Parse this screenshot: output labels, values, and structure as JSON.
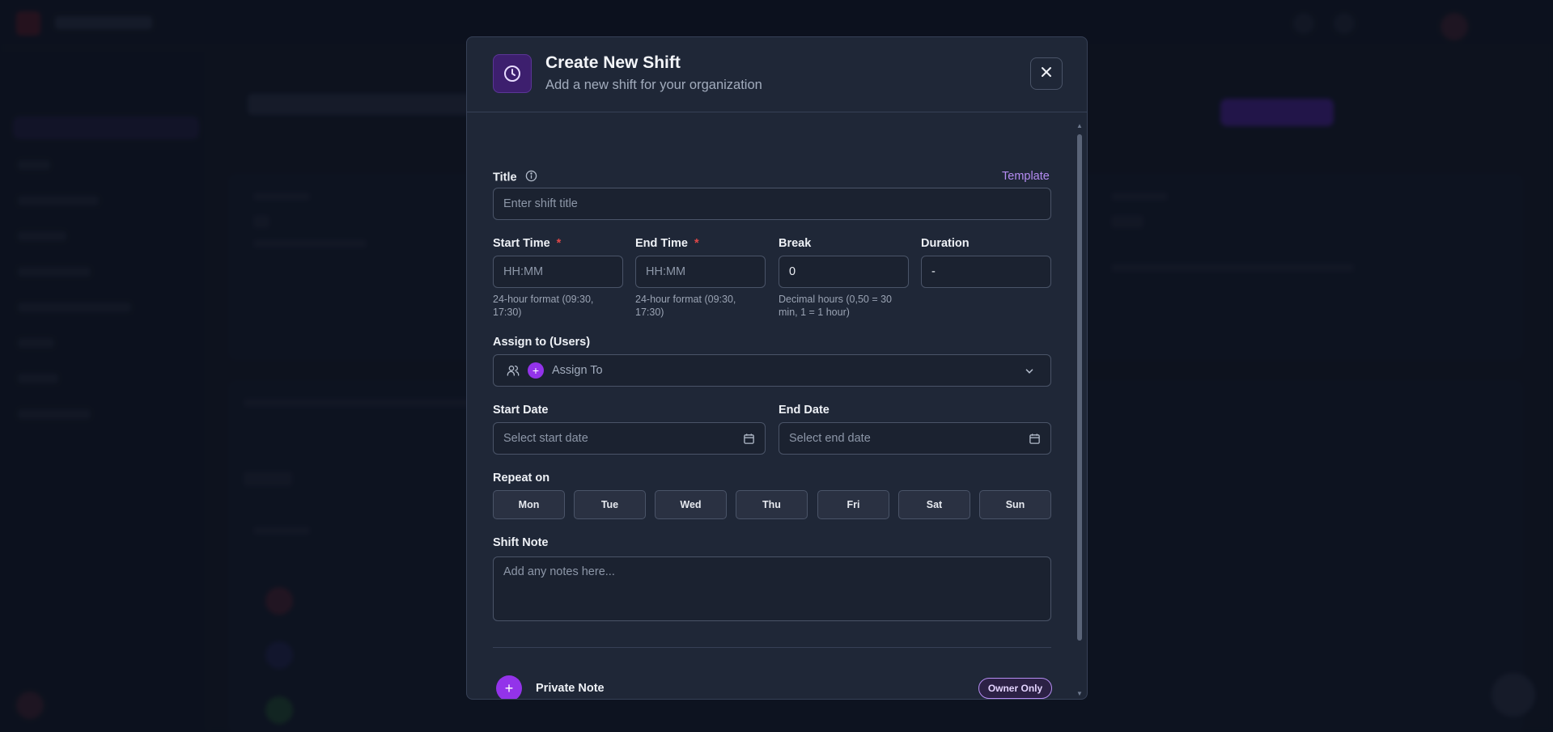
{
  "modal": {
    "title": "Create New Shift",
    "subtitle": "Add a new shift for your organization"
  },
  "form": {
    "title_label": "Title",
    "template_link": "Template",
    "title_placeholder": "Enter shift title",
    "start_time_label": "Start Time",
    "end_time_label": "End Time",
    "required_mark": "*",
    "break_label": "Break",
    "duration_label": "Duration",
    "time_placeholder": "HH:MM",
    "break_value": "0",
    "duration_value": "-",
    "time_hint": "24-hour format (09:30, 17:30)",
    "break_hint": "Decimal hours (0,50 = 30 min, 1 = 1 hour)",
    "assign_label": "Assign to (Users)",
    "assign_placeholder": "Assign To",
    "start_date_label": "Start Date",
    "start_date_placeholder": "Select start date",
    "end_date_label": "End Date",
    "end_date_placeholder": "Select end date",
    "repeat_label": "Repeat on",
    "days": [
      "Mon",
      "Tue",
      "Wed",
      "Thu",
      "Fri",
      "Sat",
      "Sun"
    ],
    "shift_note_label": "Shift Note",
    "shift_note_placeholder": "Add any notes here...",
    "private_note_label": "Private Note",
    "owner_only_badge": "Owner Only"
  },
  "colors": {
    "accent": "#9333ea",
    "link": "#b58cf2",
    "required": "#e04848",
    "modal_bg": "#1f2737"
  },
  "icons": {
    "header": "clock-icon",
    "close": "close-icon",
    "info": "info-icon",
    "users": "users-icon",
    "add": "plus-icon",
    "dropdown": "chevron-down-icon",
    "calendar": "calendar-icon"
  }
}
